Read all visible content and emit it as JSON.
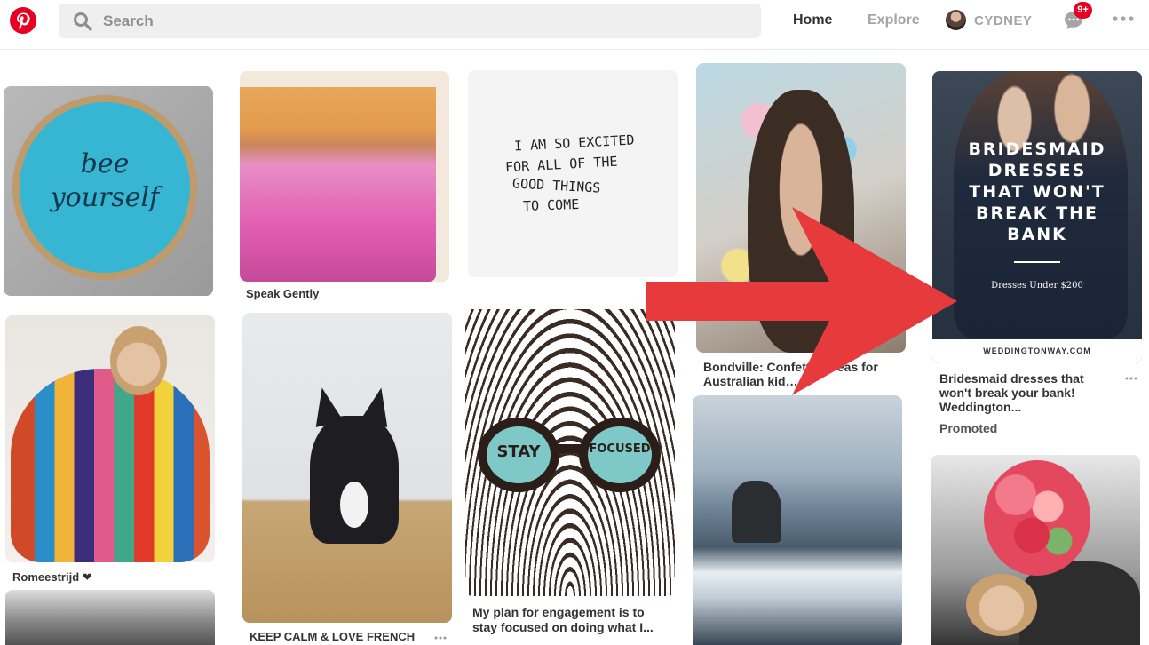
{
  "header": {
    "search_placeholder": "Search",
    "nav_home": "Home",
    "nav_explore": "Explore",
    "profile_name": "CYDNEY",
    "notification_count": "9+"
  },
  "pins": {
    "speak_gently": {
      "title": "Speak Gently"
    },
    "quote": {
      "lines": [
        "I AM SO EXCITED",
        "FOR ALL OF THE",
        "GOOD THINGS",
        "TO COME"
      ]
    },
    "bee": {
      "line1": "bee",
      "line2": "yourself"
    },
    "bondville": {
      "title": "Bondville: Confetti t… eas for Australian kid…"
    },
    "bridesmaid": {
      "overlay_lines": [
        "BRIDESMAID",
        "DRESSES",
        "THAT WON'T",
        "BREAK THE",
        "BANK"
      ],
      "overlay_sub": "Dresses Under $200",
      "footer": "WEDDINGTONWAY.COM",
      "title": "Bridesmaid dresses that won't break your bank! Weddington...",
      "promoted": "Promoted"
    },
    "romeestrijd": {
      "title": "Romeestrijd ❤"
    },
    "keep_calm": {
      "title": "KEEP CALM & LOVE FRENCH"
    },
    "stay_focused": {
      "left": "STAY",
      "right": "FOCUSED",
      "title": "My plan for engagement is to stay focused on doing what I..."
    }
  },
  "colors": {
    "brand": "#e60023",
    "arrow": "#e63a3d",
    "nav_inactive": "#a5a5a5",
    "text": "#333333"
  }
}
